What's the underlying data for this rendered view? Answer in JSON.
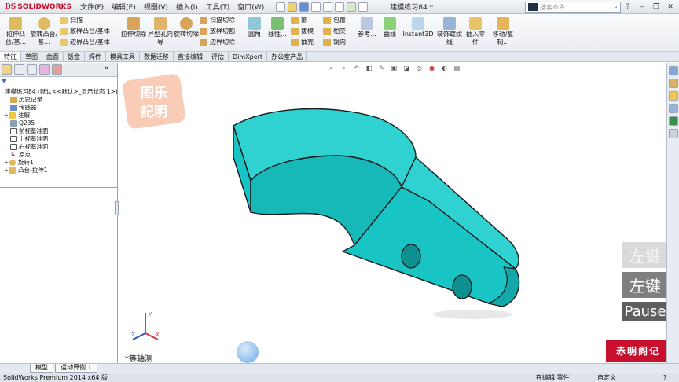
{
  "app": {
    "brand_ds": "DS",
    "brand_name": "SOLIDWORKS",
    "doc_title": "建模练习84 *",
    "search_placeholder": "搜索命令"
  },
  "menu": [
    "文件(F)",
    "编辑(E)",
    "视图(V)",
    "插入(I)",
    "工具(T)",
    "窗口(W)"
  ],
  "ribbon": {
    "extrude_boss": "拉伸凸台/基...",
    "revolve_boss": "旋转凸台/基...",
    "sweep": "扫描",
    "loft": "放样凸台/基体",
    "boundary": "边界凸台/基体",
    "extrude_cut": "拉伸切除",
    "hole_wizard": "异型孔向导",
    "revolve_cut": "旋转切除",
    "sweep_cut": "扫描切除",
    "loft_cut": "放样切割",
    "boundary_cut": "边界切除",
    "fillet": "圆角",
    "linear_pattern": "线性...",
    "rib": "筋",
    "draft": "拔模",
    "shell": "抽壳",
    "wrap": "包覆",
    "intersect": "相交",
    "mirror": "镜向",
    "reference": "参考...",
    "curves": "曲线",
    "instant3d": "Instant3D",
    "cosmetic_thread": "装饰螺纹线",
    "insert_part": "插入零件",
    "move_copy": "移动/复制..."
  },
  "command_tabs": [
    "特征",
    "草图",
    "曲面",
    "钣金",
    "焊件",
    "模具工具",
    "数据迁移",
    "直接编辑",
    "评估",
    "DimXpert",
    "办公室产品"
  ],
  "tree": {
    "root": "建模练习84  (默认<<默认>_显示状态 1>)",
    "items": [
      "历史记录",
      "传感器",
      "注解",
      "Q235",
      "前视基准面",
      "上视基准面",
      "右视基准面",
      "原点",
      "旋转1",
      "凸台-拉伸1"
    ]
  },
  "viewport": {
    "view_name": "*等轴测",
    "stamp_text": [
      "图乐",
      "記明"
    ],
    "key_ghost": "左键",
    "key_left": "左键",
    "key_pause": "Pause",
    "brand_stamp": "赤明阁记",
    "model_color": "#19c4c4"
  },
  "bottom_tabs": [
    "模型",
    "运动算例 1"
  ],
  "status": {
    "product": "SolidWorks Premium 2014 x64 版",
    "mode": "在编辑 零件",
    "units": "自定义"
  }
}
